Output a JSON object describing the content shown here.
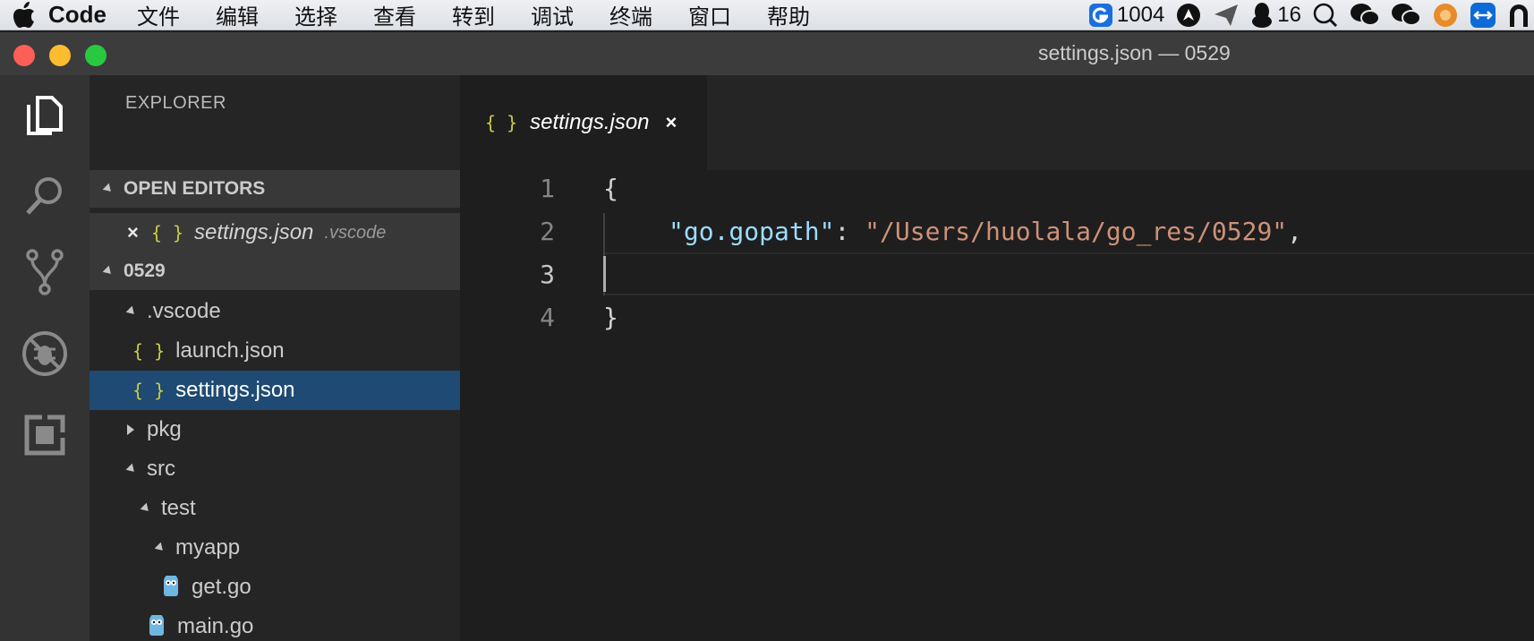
{
  "menubar": {
    "app_name": "Code",
    "items": [
      "文件",
      "编辑",
      "选择",
      "查看",
      "转到",
      "调试",
      "终端",
      "窗口",
      "帮助"
    ],
    "tray": {
      "counter_a": "1004",
      "counter_b": "16"
    }
  },
  "window": {
    "title": "settings.json — 0529"
  },
  "sidebar": {
    "title": "EXPLORER",
    "open_editors": {
      "header": "OPEN EDITORS",
      "item_name": "settings.json",
      "item_dir": ".vscode"
    },
    "folder_header": "0529",
    "tree": [
      {
        "label": ".vscode"
      },
      {
        "label": "launch.json"
      },
      {
        "label": "settings.json"
      },
      {
        "label": "pkg"
      },
      {
        "label": "src"
      },
      {
        "label": "test"
      },
      {
        "label": "myapp"
      },
      {
        "label": "get.go"
      },
      {
        "label": "main.go"
      }
    ]
  },
  "editor": {
    "tab_label": "settings.json",
    "json_glyph": "{ }",
    "close_glyph": "×",
    "line_numbers": [
      "1",
      "2",
      "3",
      "4"
    ],
    "lines": {
      "l1": "{",
      "l2_key": "\"go.gopath\"",
      "l2_colon": ": ",
      "l2_value": "\"/Users/huolala/go_res/0529\"",
      "l2_comma": ",",
      "l4": "}"
    }
  },
  "colors": {
    "accent_selected": "#1e4a73",
    "json_icon": "#cbcb41",
    "key": "#9cdcfe",
    "string": "#ce9178"
  }
}
